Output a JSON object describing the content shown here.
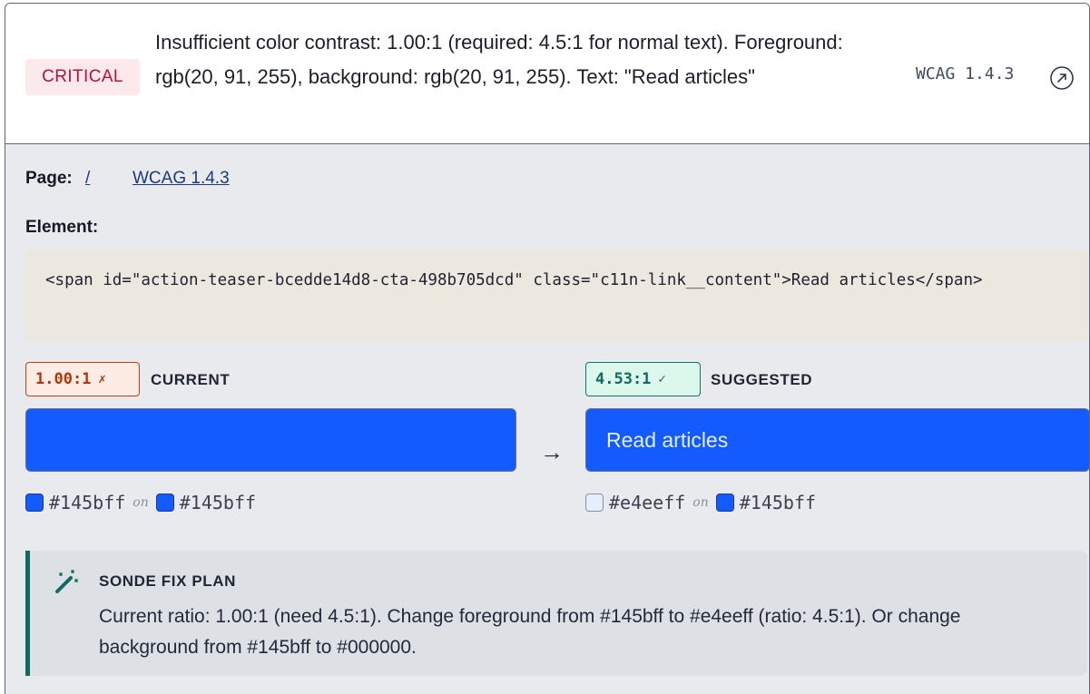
{
  "issue": {
    "severity": "CRITICAL",
    "message": "Insufficient color contrast: 1.00:1 (required: 4.5:1 for normal text). Foreground: rgb(20, 91, 255), background: rgb(20, 91, 255). Text: \"Read articles\"",
    "wcag_tag": "WCAG 1.4.3",
    "link_icon": "external-link-icon"
  },
  "details": {
    "page_label": "Page:",
    "page_link": "/",
    "wcag_link": "WCAG 1.4.3",
    "element_label": "Element:",
    "element_code": "<span id=\"action-teaser-bcedde14d8-cta-498b705dcd\" class=\"c11n-link__content\">Read articles</span>"
  },
  "current": {
    "ratio": "1.00:1",
    "status_mark": "✗",
    "label": "CURRENT",
    "preview_text": "",
    "fg": "#145bff",
    "on": "on",
    "bg": "#145bff"
  },
  "suggested": {
    "ratio": "4.53:1",
    "status_mark": "✓",
    "label": "SUGGESTED",
    "preview_text": "Read articles",
    "fg": "#e4eeff",
    "on": "on",
    "bg": "#145bff"
  },
  "arrow": "→",
  "fix_plan": {
    "icon": "magic-wand-icon",
    "title": "SONDE FIX PLAN",
    "body": "Current ratio: 1.00:1 (need 4.5:1). Change foreground from #145bff to #e4eeff (ratio: 4.5:1). Or change background from #145bff to #000000."
  },
  "colors": {
    "accent": "#145bff",
    "critical": "#b3123d",
    "fail": "#c2410c",
    "pass": "#0f766e"
  }
}
